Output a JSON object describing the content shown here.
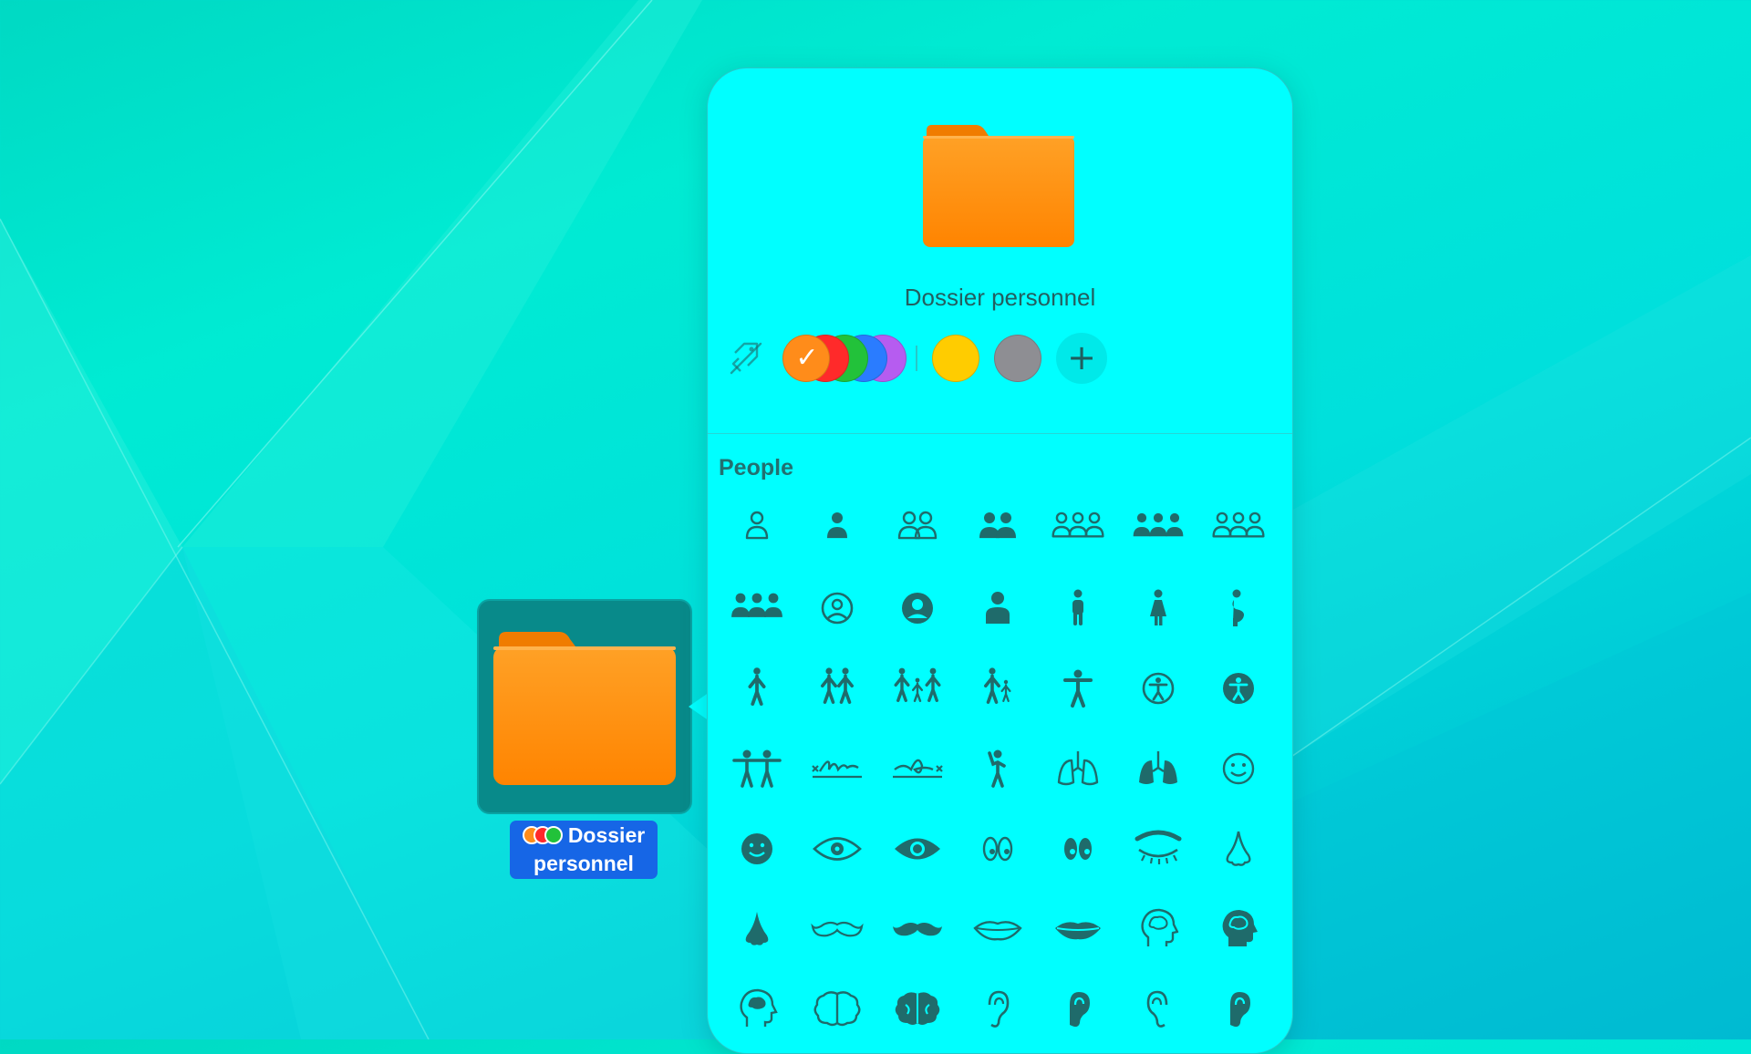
{
  "colors": {
    "panel": "#00ffff",
    "symbol": "#1f6b6b",
    "folder_orange": "#ff8c00",
    "selection_blue": "#1666e6",
    "tag_colors": [
      "#ff8c1a",
      "#ff2a2a",
      "#22c23a",
      "#2a7cff",
      "#b65cf0"
    ],
    "extra_colors": [
      "#ffcc00",
      "#8e8e93"
    ]
  },
  "desktop": {
    "folder_label_line1": "Dossier",
    "folder_label_line2": "personnel",
    "folder_icon": "folder-icon",
    "label_tag_dots": [
      "#ff8c1a",
      "#ff2a2a",
      "#22c23a"
    ]
  },
  "panel": {
    "folder_name": "Dossier personnel",
    "no_tag_icon": "tag-slash-icon",
    "add_color_icon": "plus-icon",
    "add_color_glyph": "+",
    "selected_check": "✓",
    "section_title": "People",
    "symbols": [
      "person-icon",
      "person-fill-icon",
      "person-2-icon",
      "person-2-fill-icon",
      "person-3-icon",
      "person-3-fill-icon",
      "person-3-sequence-icon",
      "person-3-sequence-fill-icon",
      "person-crop-circle-icon",
      "person-crop-circle-fill-icon",
      "person-bust-icon",
      "figure-stand-icon",
      "figure-stand-dress-icon",
      "figure-pregnant-icon",
      "figure-walk-icon",
      "figure-2-icon",
      "figure-family-icon",
      "figure-parent-child-icon",
      "figure-arms-open-icon",
      "accessibility-icon",
      "accessibility-fill-icon",
      "figure-2-arms-open-icon",
      "signature-left-icon",
      "signature-right-icon",
      "figure-wave-icon",
      "lungs-icon",
      "lungs-fill-icon",
      "face-smiling-icon",
      "face-smiling-fill-icon",
      "eye-icon",
      "eye-fill-icon",
      "eyes-icon",
      "eyes-inverse-icon",
      "eyebrow-icon",
      "nose-icon",
      "nose-fill-icon",
      "mustache-icon",
      "mustache-fill-icon",
      "mouth-icon",
      "mouth-fill-icon",
      "brain-head-profile-icon",
      "brain-head-profile-fill-icon",
      "brain-head-profile-alt-icon",
      "brain-icon",
      "brain-fill-icon",
      "ear-icon",
      "ear-fill-icon",
      "ear-trailing-icon",
      "ear-trailing-fill-icon"
    ]
  }
}
